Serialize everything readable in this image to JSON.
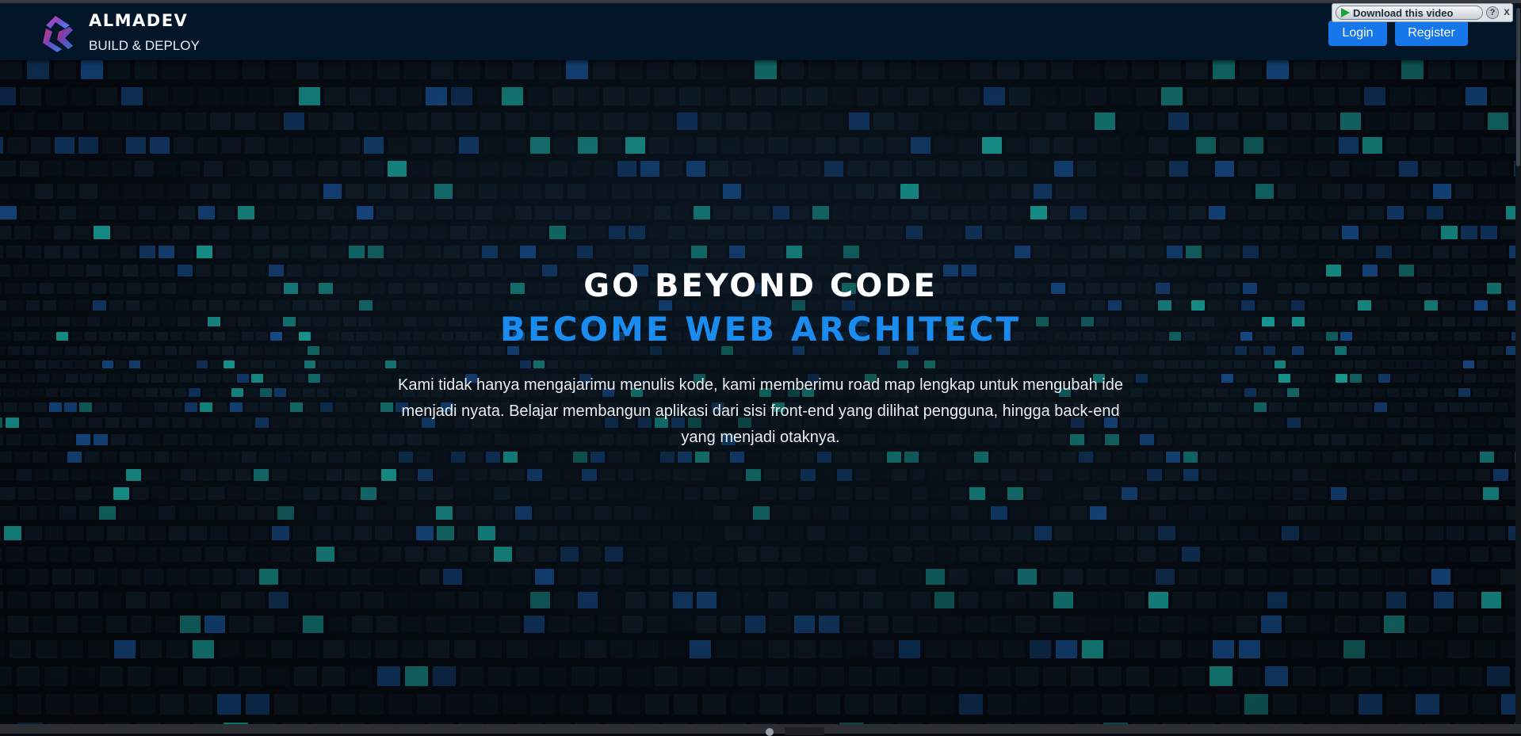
{
  "brand": {
    "name": "ALMADEV",
    "tagline": "BUILD & DEPLOY",
    "logo_colors": [
      "#e0357a",
      "#7b4fd8",
      "#3a8ef0"
    ]
  },
  "nav": {
    "login_label": "Login",
    "register_label": "Register",
    "button_color": "#1677ea"
  },
  "download_bar": {
    "label": "Download this video",
    "help_label": "?",
    "close_label": "X"
  },
  "hero": {
    "headline_line1": "GO BEYOND CODE",
    "headline_line2": "BECOME WEB ARCHITECT",
    "headline_accent_color": "#1a8cf0",
    "description": "Kami tidak hanya mengajarimu menulis kode, kami memberimu road map lengkap untuk mengubah ide menjadi nyata. Belajar membangun aplikasi dari sisi front-end yang dilihat pengguna, hingga back-end yang menjadi otaknya.",
    "background": "digital-matrix-code-grid"
  }
}
